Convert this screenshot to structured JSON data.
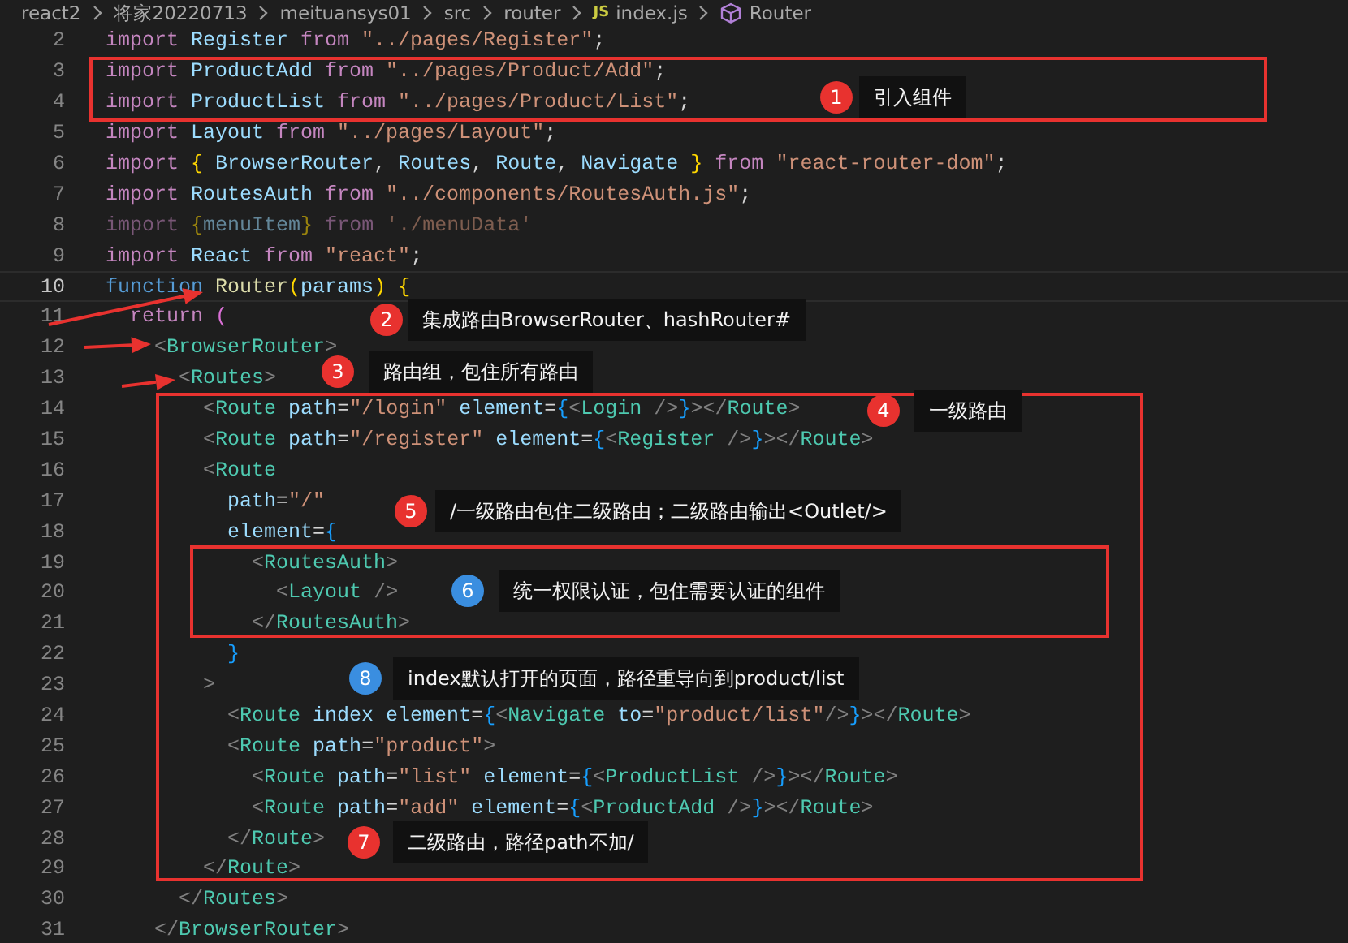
{
  "breadcrumb": [
    {
      "label": "react2"
    },
    {
      "label": "将家20220713"
    },
    {
      "label": "meituansys01"
    },
    {
      "label": "src"
    },
    {
      "label": "router"
    },
    {
      "label": "index.js",
      "badge": "JS",
      "kind": "file"
    },
    {
      "label": "Router",
      "kind": "symbol"
    }
  ],
  "editor": {
    "lines": [
      {
        "number": "2",
        "current": false,
        "faded": false,
        "tokens": [
          {
            "kind": "k",
            "text": "import "
          },
          {
            "kind": "v",
            "text": "Register "
          },
          {
            "kind": "k",
            "text": "from "
          },
          {
            "kind": "s",
            "text": "\"../pages/Register\""
          },
          {
            "kind": "p",
            "text": ";"
          }
        ]
      },
      {
        "number": "3",
        "current": false,
        "faded": false,
        "tokens": [
          {
            "kind": "k",
            "text": "import "
          },
          {
            "kind": "v",
            "text": "ProductAdd "
          },
          {
            "kind": "k",
            "text": "from "
          },
          {
            "kind": "s",
            "text": "\"../pages/Product/Add\""
          },
          {
            "kind": "p",
            "text": ";"
          }
        ]
      },
      {
        "number": "4",
        "current": false,
        "faded": false,
        "tokens": [
          {
            "kind": "k",
            "text": "import "
          },
          {
            "kind": "v",
            "text": "ProductList "
          },
          {
            "kind": "k",
            "text": "from "
          },
          {
            "kind": "s",
            "text": "\"../pages/Product/List\""
          },
          {
            "kind": "p",
            "text": ";"
          }
        ]
      },
      {
        "number": "5",
        "current": false,
        "faded": false,
        "tokens": [
          {
            "kind": "k",
            "text": "import "
          },
          {
            "kind": "v",
            "text": "Layout "
          },
          {
            "kind": "k",
            "text": "from "
          },
          {
            "kind": "s",
            "text": "\"../pages/Layout\""
          },
          {
            "kind": "p",
            "text": ";"
          }
        ]
      },
      {
        "number": "6",
        "current": false,
        "faded": false,
        "tokens": [
          {
            "kind": "k",
            "text": "import "
          },
          {
            "kind": "b1",
            "text": "{ "
          },
          {
            "kind": "v",
            "text": "BrowserRouter"
          },
          {
            "kind": "p",
            "text": ", "
          },
          {
            "kind": "v",
            "text": "Routes"
          },
          {
            "kind": "p",
            "text": ", "
          },
          {
            "kind": "v",
            "text": "Route"
          },
          {
            "kind": "p",
            "text": ", "
          },
          {
            "kind": "v",
            "text": "Navigate "
          },
          {
            "kind": "b1",
            "text": "} "
          },
          {
            "kind": "k",
            "text": "from "
          },
          {
            "kind": "s",
            "text": "\"react-router-dom\""
          },
          {
            "kind": "p",
            "text": ";"
          }
        ]
      },
      {
        "number": "7",
        "current": false,
        "faded": false,
        "tokens": [
          {
            "kind": "k",
            "text": "import "
          },
          {
            "kind": "v",
            "text": "RoutesAuth "
          },
          {
            "kind": "k",
            "text": "from "
          },
          {
            "kind": "s",
            "text": "\"../components/RoutesAuth.js\""
          },
          {
            "kind": "p",
            "text": ";"
          }
        ]
      },
      {
        "number": "8",
        "current": false,
        "faded": true,
        "tokens": [
          {
            "kind": "k",
            "text": "import "
          },
          {
            "kind": "b1",
            "text": "{"
          },
          {
            "kind": "v",
            "text": "menuItem"
          },
          {
            "kind": "b1",
            "text": "} "
          },
          {
            "kind": "k",
            "text": "from "
          },
          {
            "kind": "s",
            "text": "'./menuData'"
          }
        ]
      },
      {
        "number": "9",
        "current": false,
        "faded": false,
        "tokens": [
          {
            "kind": "k",
            "text": "import "
          },
          {
            "kind": "v",
            "text": "React "
          },
          {
            "kind": "k",
            "text": "from "
          },
          {
            "kind": "s",
            "text": "\"react\""
          },
          {
            "kind": "p",
            "text": ";"
          }
        ]
      },
      {
        "number": "10",
        "current": true,
        "faded": false,
        "tokens": [
          {
            "kind": "f",
            "text": "function "
          },
          {
            "kind": "n",
            "text": "Router"
          },
          {
            "kind": "b1",
            "text": "("
          },
          {
            "kind": "v",
            "text": "params"
          },
          {
            "kind": "b1",
            "text": ") "
          },
          {
            "kind": "b1",
            "text": "{"
          }
        ]
      },
      {
        "number": "11",
        "current": false,
        "faded": false,
        "tokens": [
          {
            "kind": "k",
            "text": "  return "
          },
          {
            "kind": "b2",
            "text": "("
          }
        ]
      },
      {
        "number": "12",
        "current": false,
        "faded": false,
        "tokens": [
          {
            "kind": "g",
            "text": "    <"
          },
          {
            "kind": "t",
            "text": "BrowserRouter"
          },
          {
            "kind": "g",
            "text": ">"
          }
        ]
      },
      {
        "number": "13",
        "current": false,
        "faded": false,
        "tokens": [
          {
            "kind": "g",
            "text": "      <"
          },
          {
            "kind": "t",
            "text": "Routes"
          },
          {
            "kind": "g",
            "text": ">"
          }
        ]
      },
      {
        "number": "14",
        "current": false,
        "faded": false,
        "tokens": [
          {
            "kind": "g",
            "text": "        <"
          },
          {
            "kind": "t",
            "text": "Route"
          },
          {
            "kind": "a",
            "text": " path"
          },
          {
            "kind": "p",
            "text": "="
          },
          {
            "kind": "s",
            "text": "\"/login\""
          },
          {
            "kind": "a",
            "text": " element"
          },
          {
            "kind": "p",
            "text": "="
          },
          {
            "kind": "b3",
            "text": "{"
          },
          {
            "kind": "g",
            "text": "<"
          },
          {
            "kind": "t",
            "text": "Login"
          },
          {
            "kind": "g",
            "text": " />"
          },
          {
            "kind": "b3",
            "text": "}"
          },
          {
            "kind": "g",
            "text": "></"
          },
          {
            "kind": "t",
            "text": "Route"
          },
          {
            "kind": "g",
            "text": ">"
          }
        ]
      },
      {
        "number": "15",
        "current": false,
        "faded": false,
        "tokens": [
          {
            "kind": "g",
            "text": "        <"
          },
          {
            "kind": "t",
            "text": "Route"
          },
          {
            "kind": "a",
            "text": " path"
          },
          {
            "kind": "p",
            "text": "="
          },
          {
            "kind": "s",
            "text": "\"/register\""
          },
          {
            "kind": "a",
            "text": " element"
          },
          {
            "kind": "p",
            "text": "="
          },
          {
            "kind": "b3",
            "text": "{"
          },
          {
            "kind": "g",
            "text": "<"
          },
          {
            "kind": "t",
            "text": "Register"
          },
          {
            "kind": "g",
            "text": " />"
          },
          {
            "kind": "b3",
            "text": "}"
          },
          {
            "kind": "g",
            "text": "></"
          },
          {
            "kind": "t",
            "text": "Route"
          },
          {
            "kind": "g",
            "text": ">"
          }
        ]
      },
      {
        "number": "16",
        "current": false,
        "faded": false,
        "tokens": [
          {
            "kind": "g",
            "text": "        <"
          },
          {
            "kind": "t",
            "text": "Route"
          }
        ]
      },
      {
        "number": "17",
        "current": false,
        "faded": false,
        "tokens": [
          {
            "kind": "a",
            "text": "          path"
          },
          {
            "kind": "p",
            "text": "="
          },
          {
            "kind": "s",
            "text": "\"/\""
          }
        ]
      },
      {
        "number": "18",
        "current": false,
        "faded": false,
        "tokens": [
          {
            "kind": "a",
            "text": "          element"
          },
          {
            "kind": "p",
            "text": "="
          },
          {
            "kind": "b3",
            "text": "{"
          }
        ]
      },
      {
        "number": "19",
        "current": false,
        "faded": false,
        "tokens": [
          {
            "kind": "g",
            "text": "            <"
          },
          {
            "kind": "t",
            "text": "RoutesAuth"
          },
          {
            "kind": "g",
            "text": ">"
          }
        ]
      },
      {
        "number": "20",
        "current": false,
        "faded": false,
        "tokens": [
          {
            "kind": "g",
            "text": "              <"
          },
          {
            "kind": "t",
            "text": "Layout"
          },
          {
            "kind": "g",
            "text": " />"
          }
        ]
      },
      {
        "number": "21",
        "current": false,
        "faded": false,
        "tokens": [
          {
            "kind": "g",
            "text": "            </"
          },
          {
            "kind": "t",
            "text": "RoutesAuth"
          },
          {
            "kind": "g",
            "text": ">"
          }
        ]
      },
      {
        "number": "22",
        "current": false,
        "faded": false,
        "tokens": [
          {
            "kind": "b3",
            "text": "          }"
          }
        ]
      },
      {
        "number": "23",
        "current": false,
        "faded": false,
        "tokens": [
          {
            "kind": "g",
            "text": "        >"
          }
        ]
      },
      {
        "number": "24",
        "current": false,
        "faded": false,
        "tokens": [
          {
            "kind": "g",
            "text": "          <"
          },
          {
            "kind": "t",
            "text": "Route"
          },
          {
            "kind": "a",
            "text": " index element"
          },
          {
            "kind": "p",
            "text": "="
          },
          {
            "kind": "b3",
            "text": "{"
          },
          {
            "kind": "g",
            "text": "<"
          },
          {
            "kind": "t",
            "text": "Navigate"
          },
          {
            "kind": "a",
            "text": " to"
          },
          {
            "kind": "p",
            "text": "="
          },
          {
            "kind": "s",
            "text": "\"product/list\""
          },
          {
            "kind": "g",
            "text": "/>"
          },
          {
            "kind": "b3",
            "text": "}"
          },
          {
            "kind": "g",
            "text": "></"
          },
          {
            "kind": "t",
            "text": "Route"
          },
          {
            "kind": "g",
            "text": ">"
          }
        ]
      },
      {
        "number": "25",
        "current": false,
        "faded": false,
        "tokens": [
          {
            "kind": "g",
            "text": "          <"
          },
          {
            "kind": "t",
            "text": "Route"
          },
          {
            "kind": "a",
            "text": " path"
          },
          {
            "kind": "p",
            "text": "="
          },
          {
            "kind": "s",
            "text": "\"product\""
          },
          {
            "kind": "g",
            "text": ">"
          }
        ]
      },
      {
        "number": "26",
        "current": false,
        "faded": false,
        "tokens": [
          {
            "kind": "g",
            "text": "            <"
          },
          {
            "kind": "t",
            "text": "Route"
          },
          {
            "kind": "a",
            "text": " path"
          },
          {
            "kind": "p",
            "text": "="
          },
          {
            "kind": "s",
            "text": "\"list\""
          },
          {
            "kind": "a",
            "text": " element"
          },
          {
            "kind": "p",
            "text": "="
          },
          {
            "kind": "b3",
            "text": "{"
          },
          {
            "kind": "g",
            "text": "<"
          },
          {
            "kind": "t",
            "text": "ProductList"
          },
          {
            "kind": "g",
            "text": " />"
          },
          {
            "kind": "b3",
            "text": "}"
          },
          {
            "kind": "g",
            "text": "></"
          },
          {
            "kind": "t",
            "text": "Route"
          },
          {
            "kind": "g",
            "text": ">"
          }
        ]
      },
      {
        "number": "27",
        "current": false,
        "faded": false,
        "tokens": [
          {
            "kind": "g",
            "text": "            <"
          },
          {
            "kind": "t",
            "text": "Route"
          },
          {
            "kind": "a",
            "text": " path"
          },
          {
            "kind": "p",
            "text": "="
          },
          {
            "kind": "s",
            "text": "\"add\""
          },
          {
            "kind": "a",
            "text": " element"
          },
          {
            "kind": "p",
            "text": "="
          },
          {
            "kind": "b3",
            "text": "{"
          },
          {
            "kind": "g",
            "text": "<"
          },
          {
            "kind": "t",
            "text": "ProductAdd"
          },
          {
            "kind": "g",
            "text": " />"
          },
          {
            "kind": "b3",
            "text": "}"
          },
          {
            "kind": "g",
            "text": "></"
          },
          {
            "kind": "t",
            "text": "Route"
          },
          {
            "kind": "g",
            "text": ">"
          }
        ]
      },
      {
        "number": "28",
        "current": false,
        "faded": false,
        "tokens": [
          {
            "kind": "g",
            "text": "          </"
          },
          {
            "kind": "t",
            "text": "Route"
          },
          {
            "kind": "g",
            "text": ">"
          }
        ]
      },
      {
        "number": "29",
        "current": false,
        "faded": false,
        "tokens": [
          {
            "kind": "g",
            "text": "        </"
          },
          {
            "kind": "t",
            "text": "Route"
          },
          {
            "kind": "g",
            "text": ">"
          }
        ]
      },
      {
        "number": "30",
        "current": false,
        "faded": false,
        "tokens": [
          {
            "kind": "g",
            "text": "      </"
          },
          {
            "kind": "t",
            "text": "Routes"
          },
          {
            "kind": "g",
            "text": ">"
          }
        ]
      },
      {
        "number": "31",
        "current": false,
        "faded": false,
        "tokens": [
          {
            "kind": "g",
            "text": "    </"
          },
          {
            "kind": "t",
            "text": "BrowserRouter"
          },
          {
            "kind": "g",
            "text": ">"
          }
        ]
      }
    ]
  },
  "annotations": [
    {
      "number": "1",
      "text": "引入组件",
      "color": "#e8322f"
    },
    {
      "number": "2",
      "text": "集成路由BrowserRouter、hashRouter#",
      "color": "#e8322f"
    },
    {
      "number": "3",
      "text": "路由组，包住所有路由",
      "color": "#e8322f"
    },
    {
      "number": "4",
      "text": "一级路由",
      "color": "#e8322f"
    },
    {
      "number": "5",
      "text": "/一级路由包住二级路由；二级路由输出<Outlet/>",
      "color": "#e8322f"
    },
    {
      "number": "6",
      "text": "统一权限认证，包住需要认证的组件",
      "color": "#3a8ee0"
    },
    {
      "number": "8",
      "text": "index默认打开的页面，路径重导向到product/list",
      "color": "#3a8ee0"
    },
    {
      "number": "7",
      "text": "二级路由，路径path不加/",
      "color": "#e8322f"
    }
  ]
}
